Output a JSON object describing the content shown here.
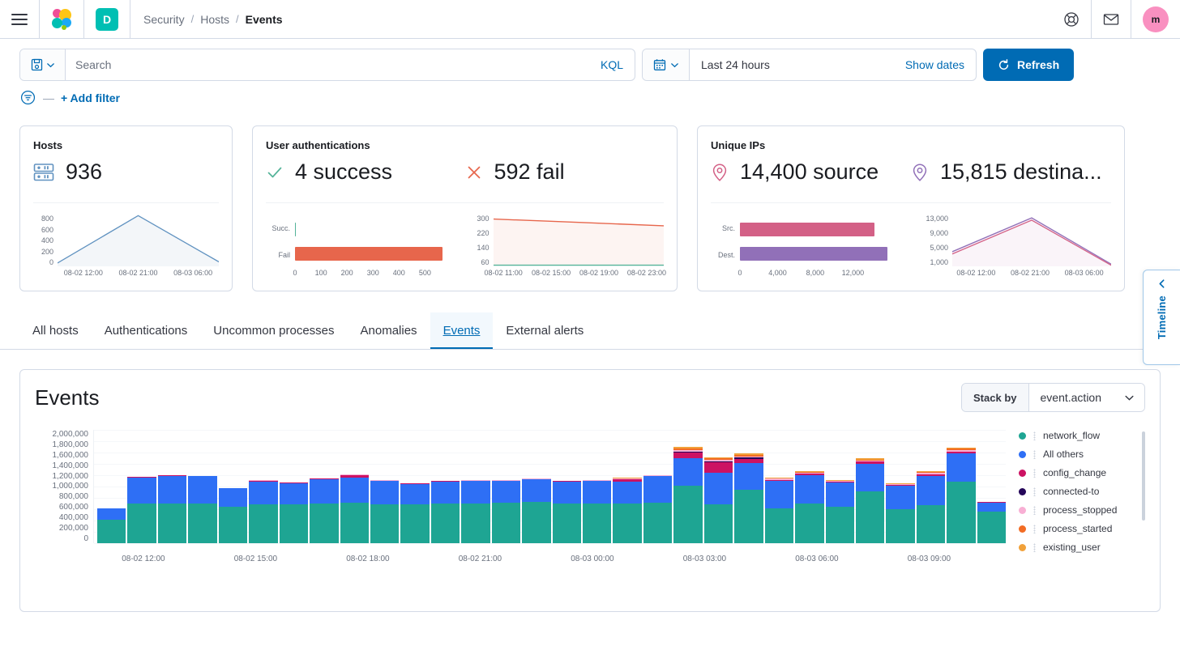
{
  "header": {
    "menu_icon": "hamburger-menu-icon",
    "logo_icon": "elastic-logo-icon",
    "space_badge": "D",
    "breadcrumbs": [
      {
        "label": "Security",
        "current": false
      },
      {
        "label": "Hosts",
        "current": false
      },
      {
        "label": "Events",
        "current": true
      }
    ],
    "breadcrumb_separator": "/",
    "help_icon": "help-lifebuoy-icon",
    "mail_icon": "mail-envelope-icon",
    "avatar_initial": "m",
    "avatar_color": "#f990c0"
  },
  "search": {
    "save_icon": "saved-query-icon",
    "chevron_icon": "chevron-down-icon",
    "placeholder": "Search",
    "value": "",
    "language_label": "KQL",
    "calendar_icon": "calendar-icon",
    "date_range": "Last 24 hours",
    "show_dates_label": "Show dates",
    "refresh_label": "Refresh",
    "refresh_icon": "refresh-icon",
    "refresh_color": "#006bb4",
    "filter_icon": "filter-icon",
    "filter_dash": "—",
    "add_filter_label": "+ Add filter"
  },
  "cards": {
    "hosts": {
      "title": "Hosts",
      "icon": "server-rack-icon",
      "value": "936",
      "chart": {
        "type": "area",
        "ylabels": [
          "800",
          "600",
          "400",
          "200",
          "0"
        ],
        "ylim": [
          0,
          900
        ],
        "xlabels": [
          "08-02 12:00",
          "08-02 21:00",
          "08-03 06:00"
        ],
        "points": [
          [
            0,
            60
          ],
          [
            1,
            855
          ],
          [
            2,
            75
          ]
        ],
        "color": "#6092c0"
      }
    },
    "authentications": {
      "title": "User authentications",
      "success_icon": "check-icon",
      "success_value": "4 success",
      "success_color": "#54b399",
      "fail_icon": "cross-icon",
      "fail_value": "592 fail",
      "fail_color": "#e7664c",
      "bar_chart": {
        "type": "bar",
        "categories": [
          "Succ.",
          "Fail"
        ],
        "values": [
          4,
          592
        ],
        "xticks": [
          "0",
          "100",
          "200",
          "300",
          "400",
          "500"
        ],
        "xlim": [
          0,
          650
        ],
        "colors": [
          "#54b399",
          "#e7664c"
        ]
      },
      "line_chart": {
        "type": "line",
        "ylabels": [
          "300",
          "220",
          "140",
          "60"
        ],
        "ylim": [
          0,
          330
        ],
        "xlabels": [
          "08-02 11:00",
          "08-02 15:00",
          "08-02 19:00",
          "08-02 23:00"
        ],
        "series": [
          {
            "name": "fail",
            "color": "#e7664c",
            "values": [
              305,
              285,
              275
            ]
          },
          {
            "name": "success",
            "color": "#54b399",
            "values": [
              2,
              2,
              2
            ]
          }
        ]
      }
    },
    "unique_ips": {
      "title": "Unique IPs",
      "source_icon": "location-pin-icon",
      "source_value": "14,400 source",
      "source_color": "#d36086",
      "destination_icon": "location-pin-icon",
      "destination_value": "15,815 destina...",
      "destination_color": "#9170b8",
      "bar_chart": {
        "type": "bar",
        "categories": [
          "Src.",
          "Dest."
        ],
        "values": [
          14400,
          15815
        ],
        "xticks": [
          "0",
          "4,000",
          "8,000",
          "12,000"
        ],
        "xlim": [
          0,
          17500
        ],
        "colors": [
          "#d36086",
          "#9170b8"
        ]
      },
      "line_chart": {
        "type": "line",
        "ylabels": [
          "13,000",
          "9,000",
          "5,000",
          "1,000"
        ],
        "ylim": [
          0,
          14000
        ],
        "xlabels": [
          "08-02 12:00",
          "08-02 21:00",
          "08-03 06:00"
        ],
        "series": [
          {
            "name": "destination",
            "color": "#9170b8",
            "values": [
              3900,
              12900,
              900
            ]
          },
          {
            "name": "source",
            "color": "#d36086",
            "values": [
              3700,
              12300,
              800
            ]
          }
        ]
      }
    }
  },
  "tabs": [
    {
      "label": "All hosts",
      "active": false
    },
    {
      "label": "Authentications",
      "active": false
    },
    {
      "label": "Uncommon processes",
      "active": false
    },
    {
      "label": "Anomalies",
      "active": false
    },
    {
      "label": "Events",
      "active": true
    },
    {
      "label": "External alerts",
      "active": false
    }
  ],
  "events_panel": {
    "title": "Events",
    "stack_by_label": "Stack by",
    "stack_by_value": "event.action",
    "stack_by_chevron": "chevron-down-icon"
  },
  "timeline": {
    "label": "Timeline",
    "chevron_icon": "chevron-left-icon",
    "color": "#006bb4"
  },
  "chart_data": {
    "type": "bar",
    "stacked": true,
    "title": "Events",
    "xlabel": "",
    "ylabel": "",
    "ylim": [
      0,
      2000000
    ],
    "yticks": [
      "2,000,000",
      "1,800,000",
      "1,600,000",
      "1,400,000",
      "1,200,000",
      "1,000,000",
      "800,000",
      "600,000",
      "400,000",
      "200,000",
      "0"
    ],
    "xticks": [
      "08-02 12:00",
      "08-02 15:00",
      "08-02 18:00",
      "08-02 21:00",
      "08-03 00:00",
      "08-03 03:00",
      "08-03 06:00",
      "08-03 09:00"
    ],
    "legend_position": "right",
    "grid": true,
    "series": [
      {
        "name": "network_flow",
        "color": "#1ea593",
        "values": [
          410000,
          700000,
          700000,
          700000,
          640000,
          690000,
          690000,
          700000,
          720000,
          690000,
          680000,
          700000,
          700000,
          720000,
          730000,
          700000,
          700000,
          700000,
          710000,
          1010000,
          690000,
          940000,
          620000,
          700000,
          640000,
          910000,
          600000,
          670000,
          1080000,
          560000
        ]
      },
      {
        "name": "All others",
        "color": "#2e6ff5",
        "values": [
          200000,
          460000,
          490000,
          480000,
          330000,
          400000,
          370000,
          430000,
          440000,
          410000,
          370000,
          390000,
          400000,
          380000,
          400000,
          390000,
          400000,
          390000,
          470000,
          490000,
          560000,
          480000,
          480000,
          500000,
          430000,
          490000,
          420000,
          520000,
          500000,
          150000
        ]
      },
      {
        "name": "config_change",
        "color": "#cc1263",
        "values": [
          6000,
          6000,
          10000,
          6000,
          4000,
          12000,
          6000,
          10000,
          40000,
          6000,
          6000,
          6000,
          6000,
          6000,
          6000,
          6000,
          6000,
          40000,
          6000,
          100000,
          180000,
          60000,
          20000,
          24000,
          10000,
          40000,
          14000,
          30000,
          30000,
          14000
        ]
      },
      {
        "name": "connected-to",
        "color": "#240659",
        "values": [
          0,
          0,
          0,
          0,
          0,
          0,
          0,
          0,
          0,
          0,
          0,
          0,
          0,
          0,
          0,
          0,
          0,
          0,
          0,
          20000,
          14000,
          30000,
          0,
          0,
          0,
          0,
          0,
          0,
          10000,
          0
        ]
      },
      {
        "name": "process_stopped",
        "color": "#f8afd4",
        "values": [
          0,
          4000,
          6000,
          4000,
          4000,
          8000,
          6000,
          6000,
          10000,
          4000,
          4000,
          4000,
          4000,
          6000,
          6000,
          6000,
          6000,
          14000,
          10000,
          26000,
          24000,
          26000,
          20000,
          20000,
          14000,
          20000,
          10000,
          20000,
          22000,
          10000
        ]
      },
      {
        "name": "process_started",
        "color": "#f26c24",
        "values": [
          0,
          0,
          0,
          0,
          0,
          0,
          0,
          0,
          0,
          0,
          0,
          0,
          0,
          0,
          0,
          0,
          0,
          6000,
          0,
          24000,
          26000,
          24000,
          10000,
          14000,
          8000,
          18000,
          6000,
          14000,
          24000,
          0
        ]
      },
      {
        "name": "existing_user",
        "color": "#f1a13a",
        "values": [
          0,
          0,
          0,
          0,
          0,
          0,
          0,
          0,
          0,
          0,
          0,
          0,
          0,
          0,
          0,
          0,
          0,
          6000,
          0,
          26000,
          26000,
          24000,
          10000,
          14000,
          8000,
          16000,
          6000,
          12000,
          24000,
          0
        ]
      }
    ]
  }
}
